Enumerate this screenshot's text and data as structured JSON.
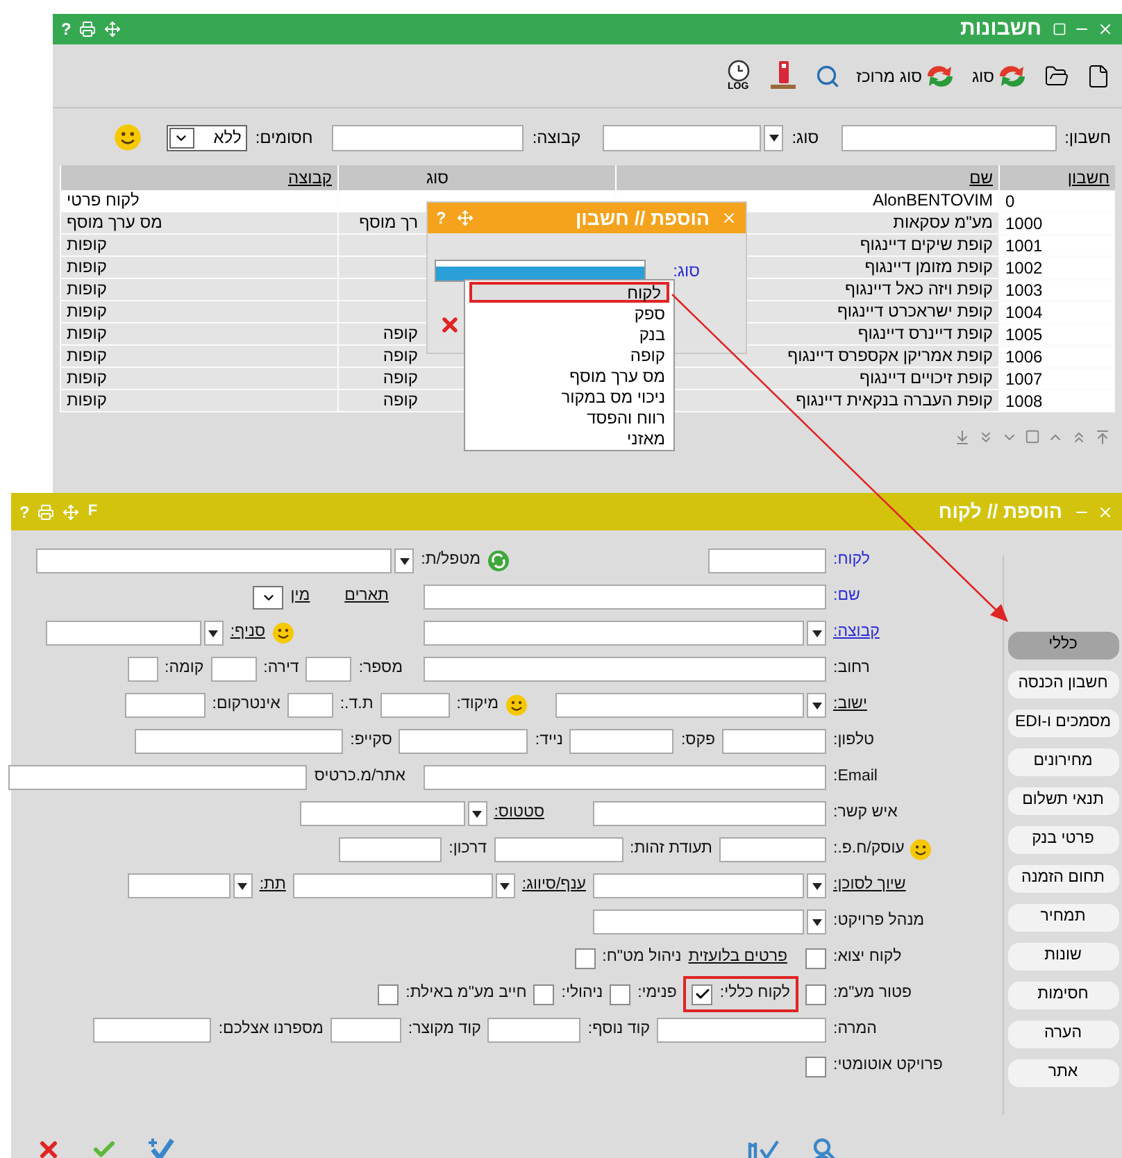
{
  "accounts_window": {
    "title": "חשבונות",
    "help": "?",
    "toolbar": {
      "type_button": "סוג",
      "bulk_type_button": "סוג מרוכז",
      "log_label": "LOG"
    },
    "filters": {
      "account_label": "חשבון:",
      "type_label": "סוג:",
      "group_label": "קבוצה:",
      "blocked_label": "חסומים:",
      "blocked_value": "ללא"
    },
    "table": {
      "columns": [
        {
          "label": "חשבון",
          "link": true
        },
        {
          "label": "שם",
          "link": true
        },
        {
          "label": "סוג",
          "link": false
        },
        {
          "label": "קבוצה",
          "link": true
        }
      ],
      "rows": [
        {
          "account": "0",
          "name": "AlonBENTOVIM",
          "group": "לקוח פרטי",
          "selected": true
        },
        {
          "account": "1000",
          "name": "מע\"מ עסקאות",
          "type": "רך מוסף",
          "group": "מס ערך מוסף",
          "selected": false
        },
        {
          "account": "1001",
          "name": "קופת שיקים דיינגוף",
          "group": "קופות",
          "selected": false
        },
        {
          "account": "1002",
          "name": "קופת מזומן דיינגוף",
          "group": "קופות",
          "selected": false
        },
        {
          "account": "1003",
          "name": "קופת ויזה כאל דיינגוף",
          "group": "קופות",
          "selected": false
        },
        {
          "account": "1004",
          "name": "קופת ישראכרט דיינגוף",
          "group": "קופות",
          "selected": false
        },
        {
          "account": "1005",
          "name": "קופת דיינרס דיינגוף",
          "type": "קופה",
          "group": "קופות",
          "selected": false
        },
        {
          "account": "1006",
          "name": "קופת אמריקן אקספרס דיינגוף",
          "type": "קופה",
          "group": "קופות",
          "selected": false
        },
        {
          "account": "1007",
          "name": "קופת זיכויים דיינגוף",
          "type": "קופה",
          "group": "קופות",
          "selected": false
        },
        {
          "account": "1008",
          "name": "קופת העברה בנקאית דיינגוף",
          "type": "קופה",
          "group": "קופות",
          "selected": false
        }
      ]
    }
  },
  "add_account_dialog": {
    "title": "הוספת // חשבון",
    "help": "?",
    "type_label": "סוג:",
    "options": [
      {
        "label": "לקוח",
        "selected": true
      },
      {
        "label": "ספק",
        "selected": false
      },
      {
        "label": "בנק",
        "selected": false
      },
      {
        "label": "קופה",
        "selected": false
      },
      {
        "label": "מס ערך מוסף",
        "selected": false
      },
      {
        "label": "ניכוי מס במקור",
        "selected": false
      },
      {
        "label": "רווח והפסד",
        "selected": false
      },
      {
        "label": "מאזני",
        "selected": false
      }
    ]
  },
  "customer_window": {
    "title": "הוספת // לקוח",
    "help": "?",
    "shortcut": "F",
    "form_rows": [
      {
        "items": [
          {
            "kind": "label",
            "text": "לקוח:",
            "accent": true,
            "link": false
          },
          {
            "kind": "input"
          },
          {
            "kind": "confirm"
          },
          {
            "kind": "label",
            "text": "מטפל/ת:",
            "accent": false,
            "link": false
          },
          {
            "kind": "select"
          }
        ]
      },
      {
        "items": [
          {
            "kind": "label",
            "text": "שם:",
            "accent": true,
            "link": false
          },
          {
            "kind": "input"
          },
          {
            "kind": "label",
            "text": "תארים",
            "accent": false,
            "link": true
          },
          {
            "kind": "label",
            "text": "מין",
            "accent": false,
            "link": true
          },
          {
            "kind": "mini"
          }
        ]
      },
      {
        "items": [
          {
            "kind": "label",
            "text": "קבוצה:",
            "accent": true,
            "link": true
          },
          {
            "kind": "select"
          },
          {
            "kind": "smiley"
          },
          {
            "kind": "label",
            "text": "סניף:",
            "accent": false,
            "link": true
          },
          {
            "kind": "select"
          }
        ]
      },
      {
        "items": [
          {
            "kind": "label",
            "text": "רחוב:",
            "accent": false,
            "link": false
          },
          {
            "kind": "input"
          },
          {
            "kind": "label",
            "text": "מספר:",
            "accent": false,
            "link": false
          },
          {
            "kind": "input"
          },
          {
            "kind": "label",
            "text": "דירה:",
            "accent": false,
            "link": false
          },
          {
            "kind": "input"
          },
          {
            "kind": "label",
            "text": "קומה:",
            "accent": false,
            "link": false
          },
          {
            "kind": "input"
          }
        ]
      },
      {
        "items": [
          {
            "kind": "label",
            "text": "ישוב:",
            "accent": false,
            "link": true
          },
          {
            "kind": "select"
          },
          {
            "kind": "smiley"
          },
          {
            "kind": "label",
            "text": "מיקוד:",
            "accent": false,
            "link": false
          },
          {
            "kind": "input"
          },
          {
            "kind": "label",
            "text": "ת.ד.:",
            "accent": false,
            "link": false
          },
          {
            "kind": "input"
          },
          {
            "kind": "label",
            "text": "אינטרקום:",
            "accent": false,
            "link": false
          },
          {
            "kind": "input"
          }
        ]
      },
      {
        "items": [
          {
            "kind": "label",
            "text": "טלפון:",
            "accent": false,
            "link": false
          },
          {
            "kind": "input"
          },
          {
            "kind": "label",
            "text": "פקס:",
            "accent": false,
            "link": false
          },
          {
            "kind": "input"
          },
          {
            "kind": "label",
            "text": "נייד:",
            "accent": false,
            "link": false
          },
          {
            "kind": "input"
          },
          {
            "kind": "label",
            "text": "סקייפ:",
            "accent": false,
            "link": false
          },
          {
            "kind": "input"
          }
        ]
      },
      {
        "items": [
          {
            "kind": "label",
            "text": "Email:",
            "accent": false,
            "link": false
          },
          {
            "kind": "input"
          },
          {
            "kind": "label",
            "text": "אתר/מ.כרטיס",
            "accent": false,
            "link": false
          },
          {
            "kind": "input"
          }
        ]
      },
      {
        "items": [
          {
            "kind": "label",
            "text": "איש קשר:",
            "accent": false,
            "link": false
          },
          {
            "kind": "input"
          },
          {
            "kind": "label",
            "text": "סטטוס:",
            "accent": false,
            "link": true
          },
          {
            "kind": "select"
          }
        ]
      },
      {
        "items": [
          {
            "kind": "smiley"
          },
          {
            "kind": "label",
            "text": "עוסק/ח.פ.:",
            "accent": false,
            "link": false
          },
          {
            "kind": "input"
          },
          {
            "kind": "label",
            "text": "תעודת זהות:",
            "accent": false,
            "link": false
          },
          {
            "kind": "input"
          },
          {
            "kind": "label",
            "text": "דרכון:",
            "accent": false,
            "link": false
          },
          {
            "kind": "input"
          }
        ]
      },
      {
        "items": [
          {
            "kind": "label",
            "text": "שיוך לסוכן:",
            "accent": false,
            "link": true
          },
          {
            "kind": "select"
          },
          {
            "kind": "label",
            "text": "ענף/סיווג:",
            "accent": false,
            "link": true
          },
          {
            "kind": "select"
          },
          {
            "kind": "label",
            "text": "תת:",
            "accent": false,
            "link": true
          },
          {
            "kind": "select"
          }
        ]
      },
      {
        "items": [
          {
            "kind": "label",
            "text": "מנהל פרויקט:",
            "accent": false,
            "link": false
          },
          {
            "kind": "select"
          }
        ]
      },
      {
        "items": [
          {
            "kind": "label",
            "text": "לקוח יצוא:",
            "accent": false,
            "link": false
          },
          {
            "kind": "checkbox",
            "checked": false
          },
          {
            "kind": "label",
            "text": "פרטים בלועזית",
            "accent": false,
            "link": true
          },
          {
            "kind": "label",
            "text": "ניהול מט\"ח:",
            "accent": false,
            "link": false
          },
          {
            "kind": "checkbox",
            "checked": false
          }
        ]
      },
      {
        "items": [
          {
            "kind": "label",
            "text": "פטור מע\"מ:",
            "accent": false,
            "link": false
          },
          {
            "kind": "checkbox",
            "checked": false
          },
          {
            "kind": "highlight",
            "items": [
              {
                "kind": "label",
                "text": "לקוח כללי:",
                "accent": false,
                "link": false
              },
              {
                "kind": "checkbox",
                "checked": true
              }
            ]
          },
          {
            "kind": "label",
            "text": "פנימי:",
            "accent": false,
            "link": false
          },
          {
            "kind": "checkbox",
            "checked": false
          },
          {
            "kind": "label",
            "text": "ניהולי:",
            "accent": false,
            "link": false
          },
          {
            "kind": "checkbox",
            "checked": false
          },
          {
            "kind": "label",
            "text": "חייב מע\"מ באילת:",
            "accent": false,
            "link": false
          },
          {
            "kind": "checkbox",
            "checked": false
          }
        ]
      },
      {
        "items": [
          {
            "kind": "label",
            "text": "המרה:",
            "accent": false,
            "link": false
          },
          {
            "kind": "input"
          },
          {
            "kind": "label",
            "text": "קוד נוסף:",
            "accent": false,
            "link": false
          },
          {
            "kind": "input"
          },
          {
            "kind": "label",
            "text": "קוד מקוצר:",
            "accent": false,
            "link": false
          },
          {
            "kind": "input"
          },
          {
            "kind": "label",
            "text": "מספרנו אצלכם:",
            "accent": false,
            "link": false
          },
          {
            "kind": "input"
          }
        ]
      },
      {
        "items": [
          {
            "kind": "label",
            "text": "פרויקט אוטומטי:",
            "accent": false,
            "link": false
          },
          {
            "kind": "checkbox",
            "checked": false
          }
        ]
      }
    ],
    "tabs": [
      {
        "label": "כללי",
        "selected": true
      },
      {
        "label": "חשבון הכנסה",
        "selected": false
      },
      {
        "label": "מסמכים ו-EDI",
        "selected": false
      },
      {
        "label": "מחירונים",
        "selected": false
      },
      {
        "label": "תנאי תשלום",
        "selected": false
      },
      {
        "label": "פרטי בנק",
        "selected": false
      },
      {
        "label": "תחום הזמנה",
        "selected": false
      },
      {
        "label": "תמחיר",
        "selected": false
      },
      {
        "label": "שונות",
        "selected": false
      },
      {
        "label": "חסימות",
        "selected": false
      },
      {
        "label": "הערה",
        "selected": false
      },
      {
        "label": "אתר",
        "selected": false
      }
    ]
  }
}
